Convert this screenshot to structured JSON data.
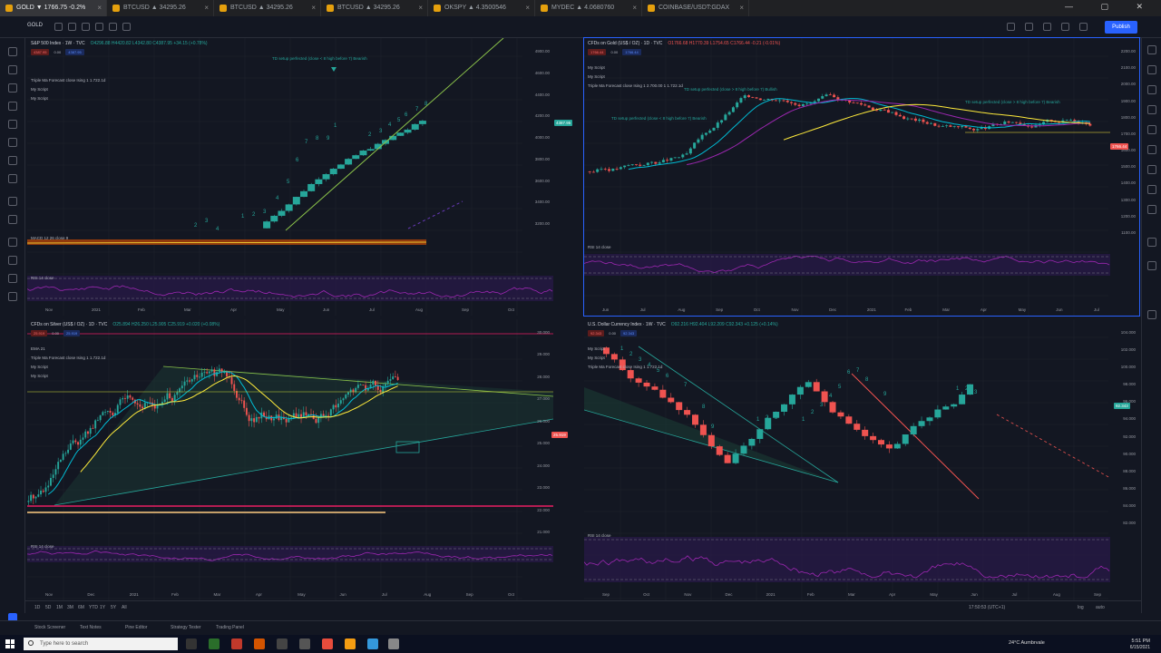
{
  "browser": {
    "tabs": [
      {
        "label": "GOLD ▼ 1766.75 -0.2%",
        "active": true
      },
      {
        "label": "BTCUSD ▲ 34295.26",
        "active": false
      },
      {
        "label": "BTCUSD ▲ 34295.26",
        "active": false
      },
      {
        "label": "BTCUSD ▲ 34295.26",
        "active": false
      },
      {
        "label": "OKSPY ▲ 4.3500546",
        "active": false
      },
      {
        "label": "MYDEC ▲ 4.0680760",
        "active": false
      },
      {
        "label": "COINBASE/USDT:GDAX",
        "active": false
      }
    ],
    "window_controls": "— ▢ ✕"
  },
  "toolbar": {
    "symbol": "GOLD",
    "publish_label": "Publish"
  },
  "panels": [
    {
      "title": "S&P 500 Index · 1W · TVC",
      "ohlc": "O4296.88 H4420.82 L4342.80 C4387.95 +34.15 (+0.78%)",
      "badge_price": "4387.95",
      "badge_val": "0.00",
      "badge_price2": "4387.95",
      "subs": [
        "Triple Ma Forecast close Ising 1 1.722.1d",
        "My Script",
        "My Script"
      ],
      "indicator": "MACD 12 26 close 9",
      "indicator2": "RSI 14 close",
      "annotation": "TD setup perfected (close < 8 high before 7) Bearish",
      "y_ticks": [
        "4900.00",
        "4600.00",
        "4400.00",
        "4200.00",
        "4000.00",
        "3800.00",
        "3600.00",
        "3400.00",
        "3200.00"
      ],
      "x_ticks": [
        "Nov",
        "2021",
        "Feb",
        "Mar",
        "Apr",
        "May",
        "Jun",
        "Jul",
        "Aug",
        "Sep",
        "Oct"
      ],
      "price_tag": "4387.95",
      "td_labels": [
        "2",
        "3",
        "4",
        "1",
        "2",
        "3",
        "4",
        "5",
        "6",
        "7",
        "8",
        "9",
        "1",
        "2",
        "3",
        "4",
        "5",
        "6",
        "7",
        "8"
      ]
    },
    {
      "title": "CFDs on Gold (US$ / OZ) · 1D · TVC",
      "ohlc": "O1766.68 H1770.39 L1754.65 C1766.44 -0.21 (-0.01%)",
      "badge_price": "1766.44",
      "badge_val": "0.00",
      "badge_price2": "1766.44",
      "subs": [
        "My Script",
        "My Script",
        "Triple Ma Forecast close Ising 1 2.700.00 1 1.722.1d"
      ],
      "indicator": "RSI 14 close",
      "annotation": "TD setup perfected (close < 8 high before 7) Bearish",
      "annotation2": "TD setup perfected (close > 8 high before 7) Bullish",
      "annotation3": "TD setup perfected (close > 8 high before 7) Bearish",
      "y_ticks": [
        "2200.00",
        "2100.00",
        "2000.00",
        "1900.00",
        "1800.00",
        "1700.00",
        "1600.00",
        "1500.00",
        "1400.00",
        "1300.00",
        "1200.00",
        "1100.00"
      ],
      "x_ticks": [
        "Jun",
        "Jul",
        "Aug",
        "Sep",
        "Oct",
        "Nov",
        "Dec",
        "2021",
        "Feb",
        "Mar",
        "Apr",
        "May",
        "Jun",
        "Jul"
      ],
      "price_tag": "1766.44"
    },
    {
      "title": "CFDs on Silver (US$ / OZ) · 1D · TVC",
      "ohlc": "O25.894 H26.250 L25.905 C25.919 +0.020 (+0.08%)",
      "badge_price": "25.919",
      "badge_val": "0.00",
      "badge_price2": "25.919",
      "subs": [
        "EMA 21",
        "Triple Ma Forecast close Ising 1 1.722.1d",
        "My Script",
        "My Script"
      ],
      "indicator": "RSI 14 close",
      "y_ticks": [
        "30.000",
        "29.000",
        "28.000",
        "27.000",
        "26.000",
        "25.000",
        "24.000",
        "23.000",
        "22.000",
        "21.000"
      ],
      "x_ticks": [
        "Nov",
        "Dec",
        "2021",
        "Feb",
        "Mar",
        "Apr",
        "May",
        "Jun",
        "Jul",
        "Aug",
        "Sep",
        "Oct"
      ],
      "price_tag": "25.919"
    },
    {
      "title": "U.S. Dollar Currency Index · 1W · TVC",
      "ohlc": "O92.216 H92.404 L92.209 C92.343 +0.125 (+0.14%)",
      "badge_price": "92.343",
      "badge_val": "0.00",
      "badge_price2": "92.343",
      "subs": [
        "My Script",
        "My Script",
        "Triple Ma Forecast close Ising 1 1.722.1d"
      ],
      "indicator": "RSI 14 close",
      "y_ticks": [
        "104.000",
        "102.000",
        "100.000",
        "98.000",
        "96.000",
        "94.000",
        "92.000",
        "90.000",
        "88.000",
        "86.000",
        "84.000",
        "82.000"
      ],
      "x_ticks": [
        "Sep",
        "Oct",
        "Nov",
        "Dec",
        "2021",
        "Feb",
        "Mar",
        "Apr",
        "May",
        "Jun",
        "Jul",
        "Aug",
        "Sep"
      ],
      "price_tag": "92.343",
      "td_labels": [
        "1",
        "2",
        "3",
        "4",
        "5",
        "6",
        "7",
        "8",
        "9",
        "1",
        "2",
        "3",
        "1",
        "2",
        "3",
        "4",
        "5",
        "6",
        "7",
        "8",
        "9",
        "1",
        "2",
        "3"
      ]
    }
  ],
  "bottombar": {
    "ranges": [
      "1D",
      "5D",
      "1M",
      "3M",
      "6M",
      "YTD",
      "1Y",
      "5Y",
      "All"
    ],
    "time": "17:50:53 (UTC+1)",
    "log": "log",
    "auto": "auto"
  },
  "bottomtabs": [
    "Stock Screener",
    "Text Notes",
    "Pine Editor",
    "Strategy Tester",
    "Trading Panel"
  ],
  "taskbar": {
    "search_placeholder": "Type here to search",
    "weather": "24°C  Aumbrvale",
    "time": "5:51 PM",
    "date": "6/15/2021"
  },
  "colors": {
    "bull": "#26a69a",
    "bear": "#ef5350",
    "bg": "#131722",
    "accent": "#2962ff"
  }
}
